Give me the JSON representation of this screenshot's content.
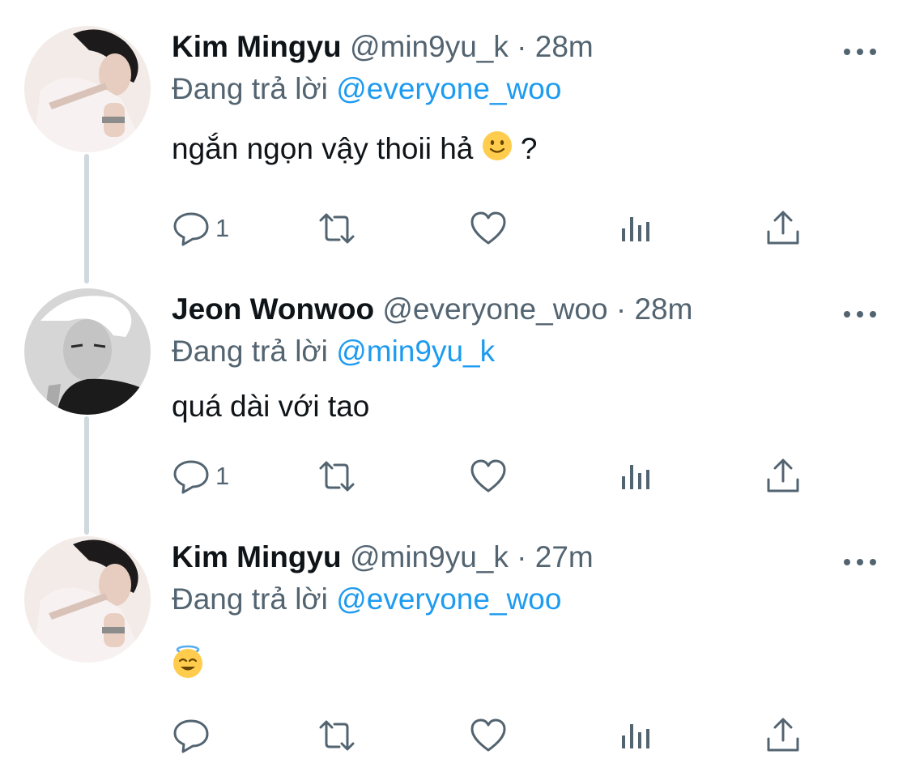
{
  "tweets": [
    {
      "name": "Kim Mingyu",
      "handle": "@min9yu_k",
      "separator": "·",
      "time": "28m",
      "replying_prefix": "Đang trả lời",
      "replying_to": "@everyone_woo",
      "text": "ngắn ngọn vậy thoii hả",
      "text_suffix": "?",
      "emoji": "slightly-smiling-face",
      "reply_count": "1",
      "avatar": "kim-mingyu-photo"
    },
    {
      "name": "Jeon Wonwoo",
      "handle": "@everyone_woo",
      "separator": "·",
      "time": "28m",
      "replying_prefix": "Đang trả lời",
      "replying_to": "@min9yu_k",
      "text": "quá dài với tao",
      "reply_count": "1",
      "avatar": "jeon-wonwoo-photo"
    },
    {
      "name": "Kim Mingyu",
      "handle": "@min9yu_k",
      "separator": "·",
      "time": "27m",
      "replying_prefix": "Đang trả lời",
      "replying_to": "@everyone_woo",
      "text": "",
      "emoji": "smiling-face-with-halo",
      "reply_count": "",
      "avatar": "kim-mingyu-photo"
    }
  ],
  "icons": {
    "reply": "reply-icon",
    "retweet": "retweet-icon",
    "like": "heart-icon",
    "views": "views-icon",
    "share": "share-icon",
    "more": "more-icon"
  },
  "colors": {
    "text": "#0f1419",
    "secondary": "#536471",
    "link": "#1d9bf0",
    "thread_line": "#cfd9de"
  }
}
